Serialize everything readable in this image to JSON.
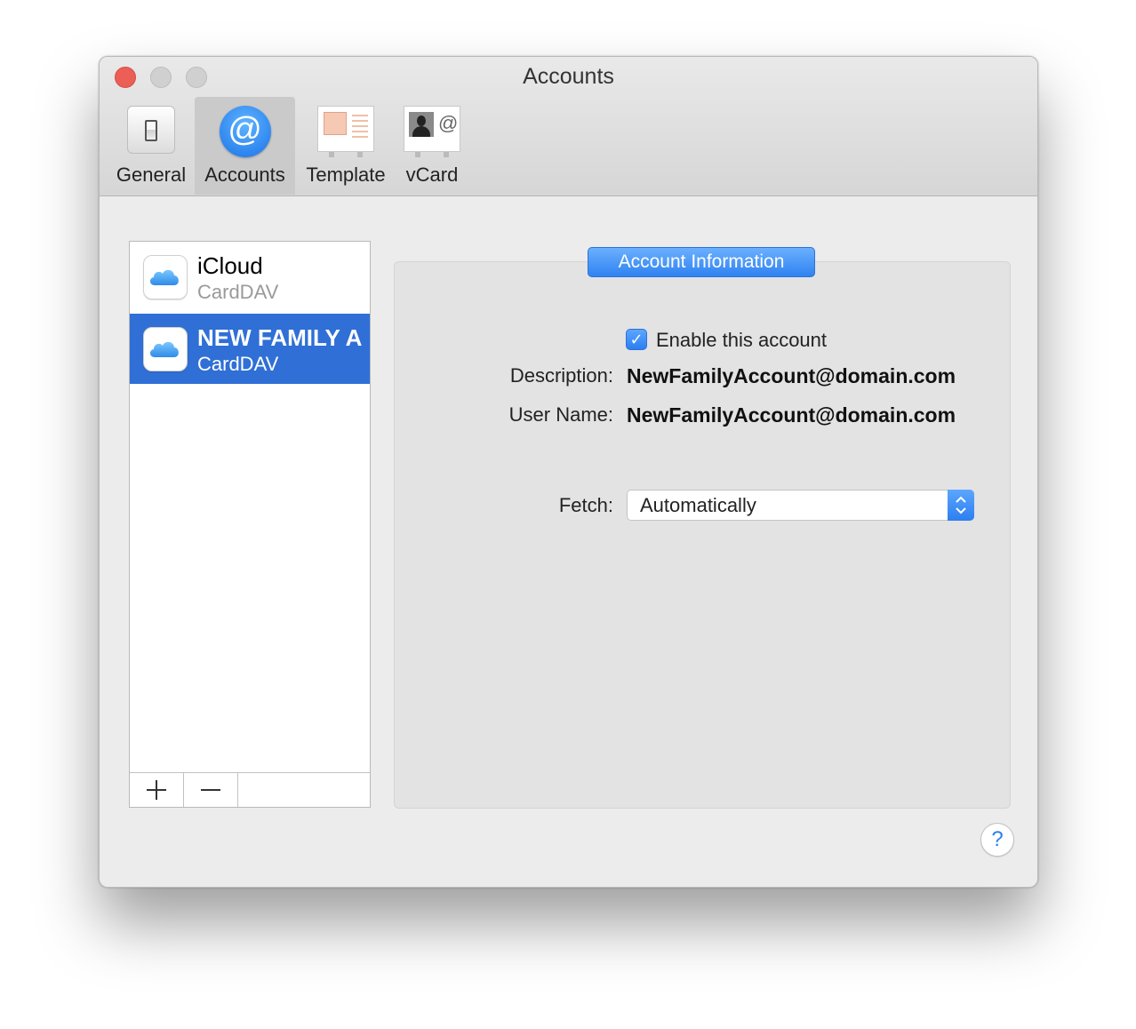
{
  "window": {
    "title": "Accounts"
  },
  "toolbar": {
    "items": [
      {
        "label": "General",
        "icon": "switch-icon"
      },
      {
        "label": "Accounts",
        "icon": "at-sign-icon",
        "selected": true
      },
      {
        "label": "Template",
        "icon": "template-icon"
      },
      {
        "label": "vCard",
        "icon": "vcard-icon"
      }
    ]
  },
  "accounts_list": {
    "items": [
      {
        "name": "iCloud",
        "type": "CardDAV",
        "icon": "icloud-icon",
        "selected": false
      },
      {
        "name": "NEW FAMILY A",
        "type": "CardDAV",
        "icon": "icloud-icon",
        "selected": true
      }
    ],
    "add_label": "+",
    "remove_label": "—"
  },
  "details": {
    "tab_label": "Account Information",
    "enable_label": "Enable this account",
    "enabled": true,
    "description_label": "Description:",
    "description_value": "NewFamilyAccount@domain.com",
    "username_label": "User Name:",
    "username_value": "NewFamilyAccount@domain.com",
    "fetch_label": "Fetch:",
    "fetch_value": "Automatically"
  },
  "help_label": "?",
  "colors": {
    "accent": "#2f6fd6",
    "close": "#ec5f57"
  }
}
